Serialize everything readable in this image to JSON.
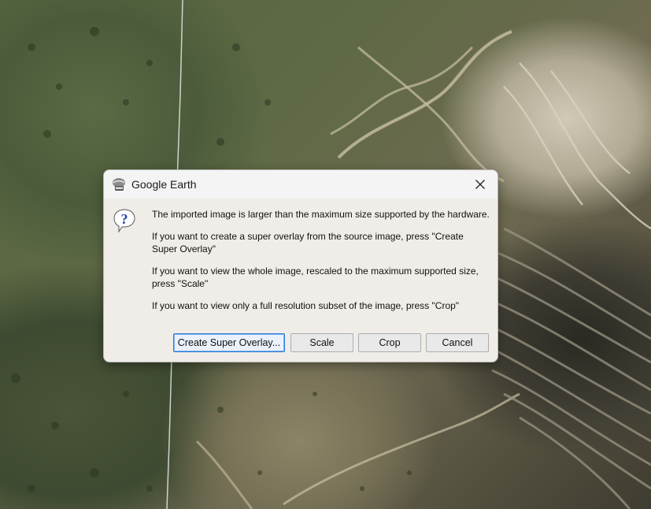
{
  "dialog": {
    "title": "Google Earth",
    "app_icon": "google-earth-icon",
    "message_icon": "question-icon",
    "messages": [
      "The imported image is larger than the maximum size supported by the hardware.",
      "If you want to create a super overlay from the source image, press \"Create Super Overlay\"",
      "If you want to view the whole image, rescaled to the maximum supported size, press \"Scale\"",
      "If you want to view only a full resolution subset of the image, press \"Crop\""
    ],
    "buttons": {
      "super_overlay": "Create Super Overlay...",
      "scale": "Scale",
      "crop": "Crop",
      "cancel": "Cancel"
    }
  },
  "colors": {
    "dialog_bg": "#f0ede8",
    "default_button_border": "#2a78d8"
  }
}
